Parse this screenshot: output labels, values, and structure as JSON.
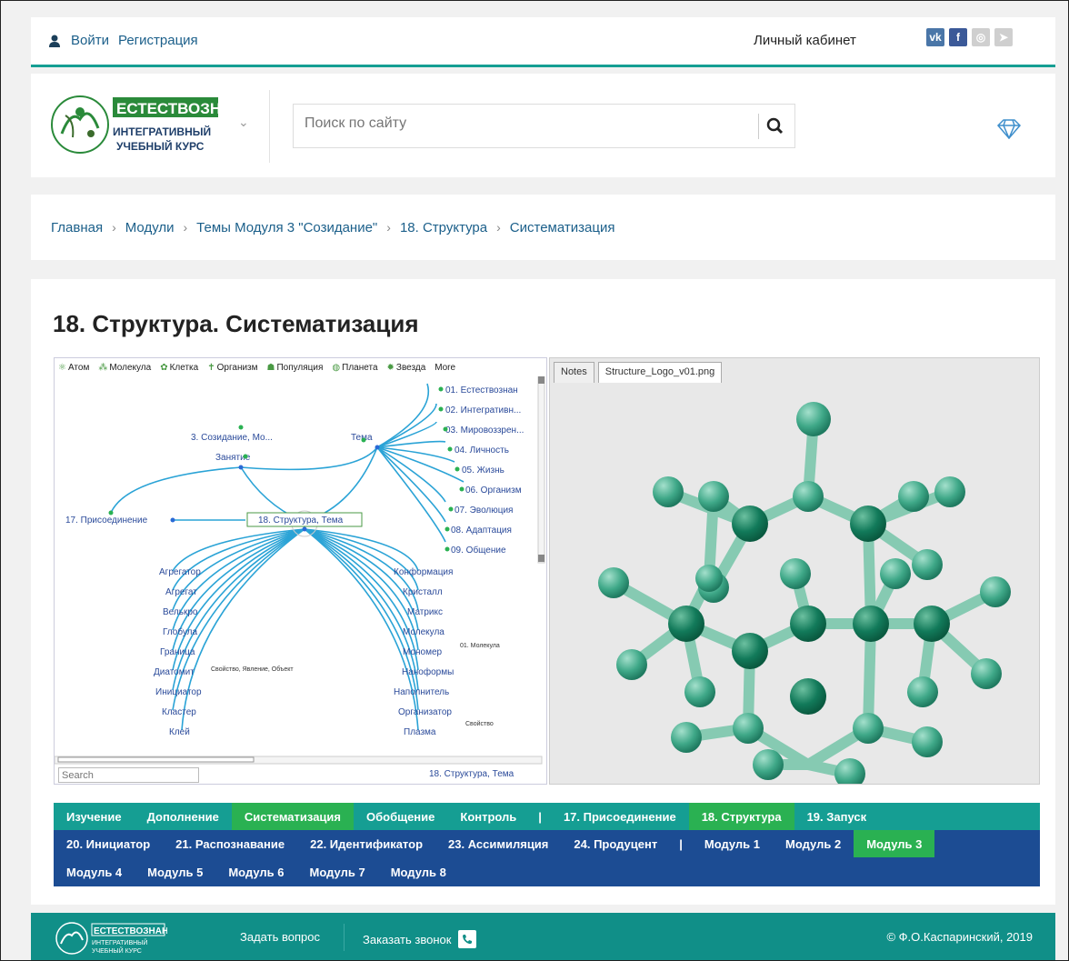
{
  "topbar": {
    "login": "Войти",
    "register": "Регистрация",
    "cabinet": "Личный кабинет",
    "social": [
      {
        "name": "vk",
        "label": "vk",
        "color": "#4a76a8"
      },
      {
        "name": "facebook",
        "label": "f",
        "color": "#3b5998"
      },
      {
        "name": "instagram",
        "label": "◎",
        "color": "#cfcfcf"
      },
      {
        "name": "telegram",
        "label": "➤",
        "color": "#cfcfcf"
      }
    ]
  },
  "header": {
    "logo_line1": "ЕСТЕСТВОЗНАНИЕ",
    "logo_line2": "ИНТЕГРАТИВНЫЙ",
    "logo_line3": "УЧЕБНЫЙ КУРС",
    "search_placeholder": "Поиск по сайту"
  },
  "breadcrumb": [
    "Главная",
    "Модули",
    "Темы Модуля 3 \"Созидание\"",
    "18. Структура",
    "Систематизация"
  ],
  "page_title": "18. Структура. Систематизация",
  "mindmap": {
    "toolbar": [
      "Атом",
      "Молекула",
      "Клетка",
      "Организм",
      "Популяция",
      "Планета",
      "Звезда",
      "More"
    ],
    "nodes_top": [
      "3. Созидание, Мо...",
      "Занятие",
      "Тема"
    ],
    "nodes_right": [
      "01. Естествознан",
      "02. Интегративн...",
      "03. Мировоззрен...",
      "04. Личность",
      "05. Жизнь",
      "06. Организм",
      "07. Эволюция",
      "08. Адаптация",
      "09. Общение"
    ],
    "node_left": "17. Присоединение",
    "node_center": "18. Структура, Тема",
    "children_left": [
      "Агрегатор",
      "Агрегат",
      "Велькро",
      "Глобула",
      "Граница",
      "Диатомит",
      "Инициатор",
      "Кластер",
      "Клей"
    ],
    "children_right": [
      "Конформация",
      "Кристалл",
      "Матрикс",
      "Молекула",
      "Мономер",
      "Наноформы",
      "Наполнитель",
      "Организатор",
      "Плазма"
    ],
    "note_left": "Свойство, Явление, Объект",
    "note_right1": "01. Молекула",
    "note_right2": "Свойство",
    "search_placeholder": "Search",
    "footer_label": "18. Структура, Тема"
  },
  "viewer": {
    "tabs": [
      "Notes",
      "Structure_Logo_v01.png"
    ]
  },
  "nav_row1": [
    "Изучение",
    "Дополнение",
    "Систематизация",
    "Обобщение",
    "Контроль",
    "|",
    "17. Присоединение",
    "18. Структура",
    "19. Запуск"
  ],
  "nav_row2": [
    "20. Инициатор",
    "21. Распознавание",
    "22. Идентификатор",
    "23. Ассимиляция",
    "24. Продуцент",
    "|",
    "Модуль 1",
    "Модуль 2",
    "Модуль 3"
  ],
  "nav_row3": [
    "Модуль 4",
    "Модуль 5",
    "Модуль 6",
    "Модуль 7",
    "Модуль 8"
  ],
  "footer": {
    "ask": "Задать вопрос",
    "call": "Заказать звонок",
    "copyright": "© Ф.О.Каспаринский, 2019"
  },
  "colors": {
    "teal": "#159e93",
    "blue": "#1c4c93",
    "green_active": "#2ab152",
    "link": "#1b5f8a"
  }
}
